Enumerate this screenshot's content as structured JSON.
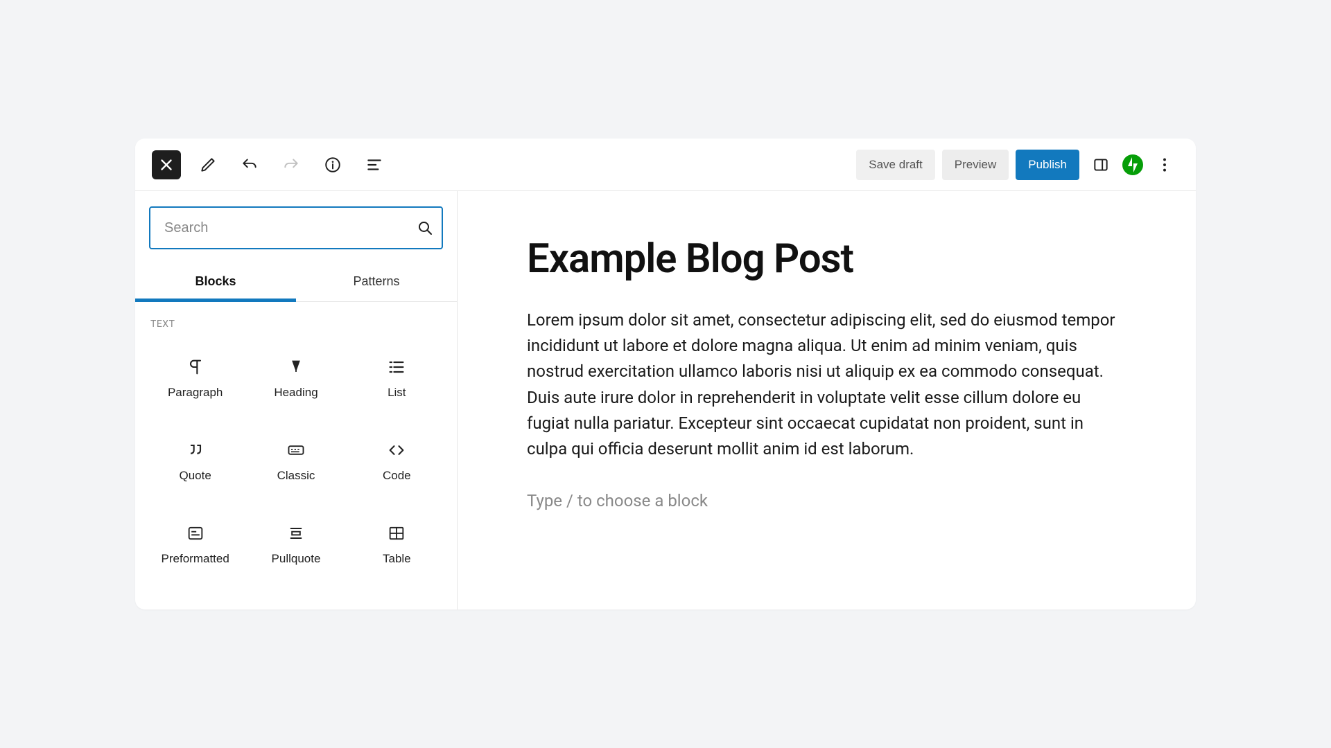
{
  "toolbar": {
    "save_draft_label": "Save draft",
    "preview_label": "Preview",
    "publish_label": "Publish"
  },
  "inserter": {
    "search_placeholder": "Search",
    "tabs": {
      "blocks": "Blocks",
      "patterns": "Patterns"
    },
    "section_title": "TEXT",
    "blocks": {
      "paragraph": "Paragraph",
      "heading": "Heading",
      "list": "List",
      "quote": "Quote",
      "classic": "Classic",
      "code": "Code",
      "preformatted": "Preformatted",
      "pullquote": "Pullquote",
      "table": "Table"
    }
  },
  "post": {
    "title": "Example Blog Post",
    "body": "Lorem ipsum dolor sit amet, consectetur adipiscing elit, sed do eiusmod tempor incididunt ut labore et dolore magna aliqua. Ut enim ad minim veniam, quis nostrud exercitation ullamco laboris nisi ut aliquip ex ea commodo consequat. Duis aute irure dolor in reprehenderit in voluptate velit esse cillum dolore eu fugiat nulla pariatur. Excepteur sint occaecat cupidatat non proident, sunt in culpa qui officia deserunt mollit anim id est laborum.",
    "placeholder": "Type / to choose a block"
  },
  "colors": {
    "accent": "#1279be",
    "jetpack": "#069e08"
  }
}
